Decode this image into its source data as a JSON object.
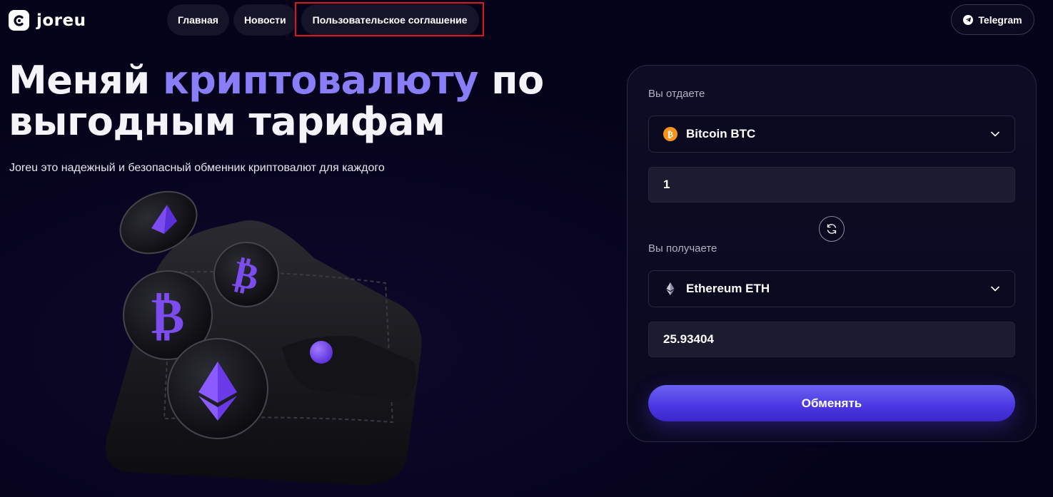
{
  "header": {
    "logo_text": "joreu",
    "nav": [
      {
        "label": "Главная"
      },
      {
        "label": "Новости"
      },
      {
        "label": "Пользовательское соглашение"
      }
    ],
    "telegram_label": "Telegram"
  },
  "hero": {
    "title_part1": "Меняй ",
    "title_accent": "криптовалюту",
    "title_part2": " по",
    "title_line2": "выгодным тарифам",
    "subtitle": "Joreu это надежный и безопасный обменник криптовалют для каждого",
    "accent_color": "#8a7df8"
  },
  "exchange": {
    "give": {
      "label": "Вы отдаете",
      "coin": "Bitcoin BTC",
      "icon": "bitcoin-icon",
      "amount": "1"
    },
    "receive": {
      "label": "Вы получаете",
      "coin": "Ethereum ETH",
      "icon": "ethereum-icon",
      "amount": "25.93404"
    },
    "swap_icon": "swap-arrows-icon",
    "submit_label": "Обменять",
    "button_color": "#4a36e2"
  }
}
